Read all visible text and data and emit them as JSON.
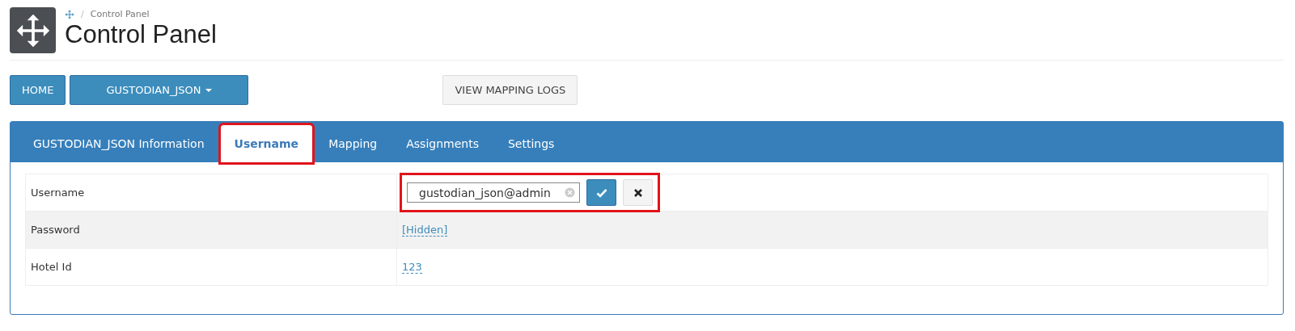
{
  "breadcrumb": {
    "separator": "/",
    "items": [
      "Control Panel"
    ]
  },
  "page_title": "Control Panel",
  "toolbar": {
    "buttons": [
      {
        "label": "HOME",
        "kind": "primary"
      },
      {
        "label": "GUSTODIAN_JSON",
        "kind": "dropdown"
      },
      {
        "label": "VIEW MAPPING LOGS",
        "kind": "default"
      }
    ]
  },
  "tabs": [
    {
      "label": "GUSTODIAN_JSON Information",
      "selected": false,
      "highlighted": false
    },
    {
      "label": "Username",
      "selected": true,
      "highlighted": true
    },
    {
      "label": "Mapping",
      "selected": false,
      "highlighted": false
    },
    {
      "label": "Assignments",
      "selected": false,
      "highlighted": false
    },
    {
      "label": "Settings",
      "selected": false,
      "highlighted": false
    }
  ],
  "rows": [
    {
      "label": "Username",
      "kind": "editor",
      "value": "gustodian_json@admin",
      "highlighted": true
    },
    {
      "label": "Password",
      "kind": "link",
      "value": "[Hidden]"
    },
    {
      "label": "Hotel Id",
      "kind": "link",
      "value": "123"
    }
  ]
}
